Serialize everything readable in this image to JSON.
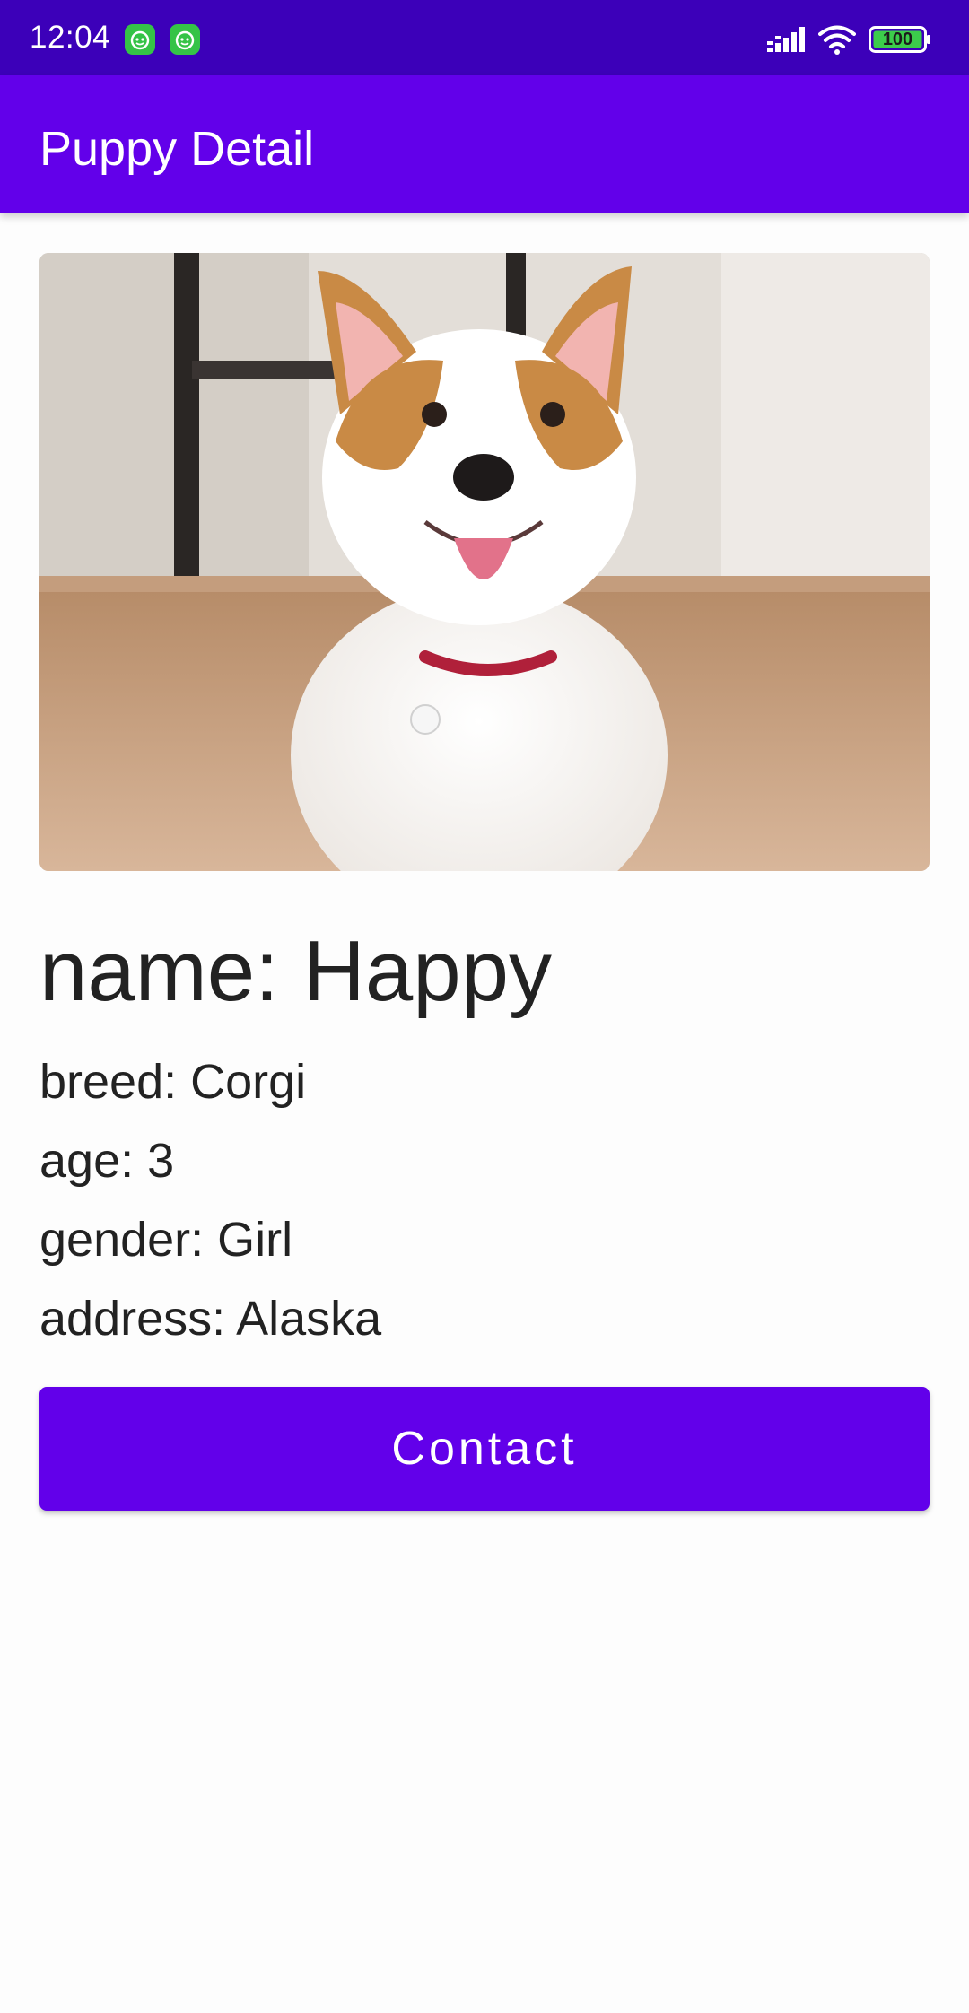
{
  "status_bar": {
    "time": "12:04",
    "battery_level": "100",
    "icons": [
      "notification-app-icon",
      "notification-app-icon",
      "signal-icon",
      "wifi-icon",
      "battery-icon"
    ]
  },
  "app_bar": {
    "title": "Puppy Detail"
  },
  "puppy": {
    "image_alt": "corgi-puppy-photo",
    "name_line": "name: Happy",
    "breed_line": "breed: Corgi",
    "age_line": "age: 3",
    "gender_line": "gender: Girl",
    "address_line": "address: Alaska"
  },
  "actions": {
    "contact_label": "Contact"
  },
  "colors": {
    "status_bar": "#3c00b9",
    "primary": "#6200ea",
    "on_primary": "#ffffff",
    "text": "#222222",
    "background": "#fdfdfd"
  }
}
